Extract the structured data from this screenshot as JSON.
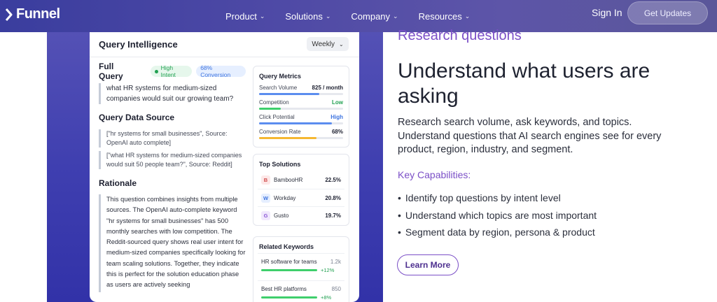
{
  "nav": {
    "brand": "Funnel",
    "links": [
      {
        "label": "Product"
      },
      {
        "label": "Solutions"
      },
      {
        "label": "Company"
      },
      {
        "label": "Resources"
      }
    ],
    "sign_in": "Sign In",
    "cta": "Get Updates"
  },
  "card": {
    "title": "Query Intelligence",
    "period": "Weekly",
    "full_query": {
      "title": "Full Query",
      "intent_badge": "High Intent",
      "conversion_badge": "68% Conversion",
      "text": "what HR systems for medium-sized companies would suit our growing team?"
    },
    "data_source": {
      "title": "Query Data Source",
      "items": [
        "[\"hr systems for small businesses\", Source: OpenAI auto complete]",
        "[\"what HR systems for medium-sized companies would suit 50 people team?\", Source: Reddit]"
      ]
    },
    "rationale": {
      "title": "Rationale",
      "text": "This question combines insights from multiple sources. The OpenAI auto-complete keyword \"hr systems for small businesses\" has 500 monthly searches with low competition. The Reddit-sourced query shows real user intent for medium-sized companies specifically looking for team scaling solutions. Together, they indicate this is perfect for the solution education phase as users are actively seeking"
    },
    "metrics": {
      "title": "Query Metrics",
      "rows": [
        {
          "label": "Search Volume",
          "value": "825 / month",
          "fill": 0.72,
          "color": "#5b8def",
          "value_color": "#1d2030"
        },
        {
          "label": "Competition",
          "value": "Low",
          "fill": 0.26,
          "color": "#3fcf6c",
          "value_color": "#22a152"
        },
        {
          "label": "Click Potential",
          "value": "High",
          "fill": 0.87,
          "color": "#5b8def",
          "value_color": "#3e74e0"
        },
        {
          "label": "Conversion Rate",
          "value": "68%",
          "fill": 0.68,
          "color": "#f5b731",
          "value_color": "#1d2030"
        }
      ]
    },
    "top_solutions": {
      "title": "Top Solutions",
      "items": [
        {
          "icon": "B",
          "name": "BambooHR",
          "value": "22.5%",
          "icon_bg": "#fde8e8",
          "icon_fg": "#d04b4b"
        },
        {
          "icon": "W",
          "name": "Workday",
          "value": "20.8%",
          "icon_bg": "#e6efff",
          "icon_fg": "#3e74e0"
        },
        {
          "icon": "G",
          "name": "Gusto",
          "value": "19.7%",
          "icon_bg": "#f1e8fd",
          "icon_fg": "#8a56d6"
        }
      ]
    },
    "related_keywords": {
      "title": "Related Keywords",
      "items": [
        {
          "name": "HR software for teams",
          "volume": "1.2k",
          "change": "+12%"
        },
        {
          "name": "Best HR platforms",
          "volume": "850",
          "change": "+8%"
        }
      ]
    }
  },
  "content": {
    "eyebrow": "Research questions",
    "headline": "Understand what users are asking",
    "lead": "Research search volume, ask keywords, and topics. Understand questions that AI search engines see for every product, region, industry, and segment.",
    "capabilities_title": "Key Capabilities:",
    "capabilities": [
      "Identify top questions by intent level",
      "Understand which topics are most important",
      "Segment data by region, persona & product"
    ],
    "button": "Learn More"
  }
}
